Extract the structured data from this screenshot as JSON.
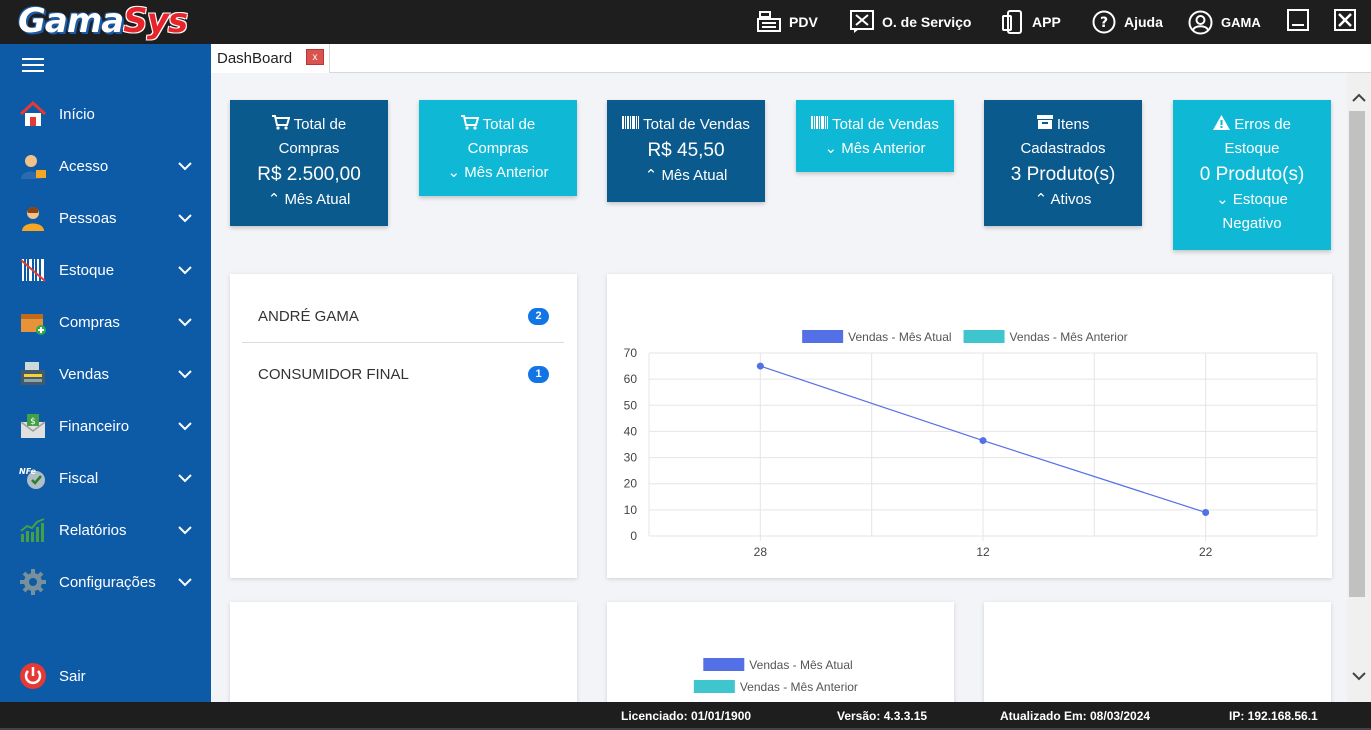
{
  "app": {
    "logo_part1": "Gama",
    "logo_part2": "Sys"
  },
  "topbar": {
    "items": [
      {
        "label": "PDV",
        "icon": "cash-register-icon"
      },
      {
        "label": "O. de Serviço",
        "icon": "service-order-icon"
      },
      {
        "label": "APP",
        "icon": "mobile-app-icon"
      },
      {
        "label": "Ajuda",
        "icon": "help-icon"
      },
      {
        "label": "GAMA",
        "icon": "user-icon"
      }
    ]
  },
  "sidebar": {
    "items": [
      {
        "label": "Início",
        "icon": "home-icon",
        "expandable": false
      },
      {
        "label": "Acesso",
        "icon": "access-user-icon",
        "expandable": true
      },
      {
        "label": "Pessoas",
        "icon": "people-icon",
        "expandable": true
      },
      {
        "label": "Estoque",
        "icon": "barcode-stock-icon",
        "expandable": true
      },
      {
        "label": "Compras",
        "icon": "purchase-box-icon",
        "expandable": true
      },
      {
        "label": "Vendas",
        "icon": "sales-register-icon",
        "expandable": true
      },
      {
        "label": "Financeiro",
        "icon": "money-envelope-icon",
        "expandable": true
      },
      {
        "label": "Fiscal",
        "icon": "nfe-fiscal-icon",
        "expandable": true
      },
      {
        "label": "Relatórios",
        "icon": "bar-chart-icon",
        "expandable": true
      },
      {
        "label": "Configurações",
        "icon": "gear-icon",
        "expandable": true
      }
    ],
    "logout_label": "Sair"
  },
  "tab": {
    "label": "DashBoard",
    "close": "x"
  },
  "cards": [
    {
      "title": "Total de Compras",
      "value": "R$ 2.500,00",
      "footer": "Mês Atual",
      "footer_dir": "up",
      "icon": "cart-icon",
      "color": "dark"
    },
    {
      "title": "Total de Compras",
      "value": "",
      "footer": "Mês Anterior",
      "footer_dir": "down",
      "icon": "cart-icon",
      "color": "light"
    },
    {
      "title": "Total de Vendas",
      "value": "R$ 45,50",
      "footer": "Mês Atual",
      "footer_dir": "up",
      "icon": "barcode-icon",
      "color": "dark"
    },
    {
      "title": "Total de Vendas",
      "value": "",
      "footer": "Mês Anterior",
      "footer_dir": "down",
      "icon": "barcode-icon",
      "color": "light"
    },
    {
      "title": "Itens Cadastrados",
      "value": "3 Produto(s)",
      "footer": "Ativos",
      "footer_dir": "up",
      "icon": "archive-icon",
      "color": "dark"
    },
    {
      "title": "Erros de Estoque",
      "value": "0 Produto(s)",
      "footer": "Estoque Negativo",
      "footer_dir": "down",
      "icon": "warning-icon",
      "color": "light"
    }
  ],
  "clients": [
    {
      "name": "ANDRÉ GAMA",
      "count": "2"
    },
    {
      "name": "CONSUMIDOR FINAL",
      "count": "1"
    }
  ],
  "colors": {
    "series_current": "#5470e6",
    "series_previous": "#3ec5cd",
    "sidebar": "#0d5aa7",
    "card_dark": "#0b5a8e",
    "card_light": "#0fb8d4"
  },
  "chart_data": [
    {
      "type": "line",
      "legend": [
        "Vendas - Mês Atual",
        "Vendas - Mês Anterior"
      ],
      "legend_position": "top",
      "categories": [
        "28",
        "12",
        "22"
      ],
      "series": [
        {
          "name": "Vendas - Mês Atual",
          "values": [
            65,
            36.5,
            9
          ]
        },
        {
          "name": "Vendas - Mês Anterior",
          "values": []
        }
      ],
      "yticks": [
        "0",
        "10",
        "20",
        "30",
        "40",
        "50",
        "60",
        "70"
      ],
      "ylim": [
        0,
        70
      ],
      "grid": true
    },
    {
      "type": "line",
      "legend": [
        "Vendas - Mês Atual",
        "Vendas - Mês Anterior"
      ],
      "legend_position": "top"
    }
  ],
  "status": {
    "licensed": "Licenciado: 01/01/1900",
    "version": "Versão: 4.3.3.15",
    "updated": "Atualizado Em: 08/03/2024",
    "ip": "IP: 192.168.56.1"
  }
}
